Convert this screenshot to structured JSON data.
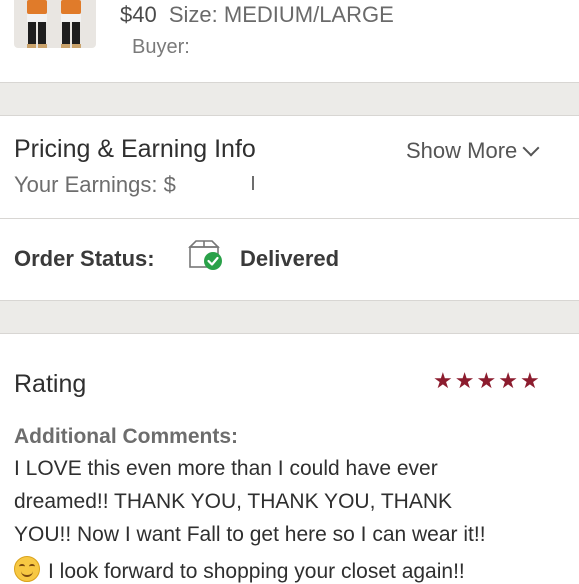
{
  "order": {
    "price": "$40",
    "size_label": "Size: MEDIUM/LARGE",
    "buyer_label": "Buyer:"
  },
  "pricing": {
    "title": "Pricing & Earning Info",
    "show_more": "Show More",
    "earnings_label": "Your Earnings: $"
  },
  "status": {
    "label": "Order Status:",
    "value": "Delivered",
    "icon": "package-delivered-icon"
  },
  "rating": {
    "title": "Rating",
    "stars": 5,
    "star_color": "#8c1c2e",
    "comments_label": "Additional Comments:",
    "comment_lines": [
      "I LOVE this even more than I could have ever",
      "dreamed!! THANK YOU, THANK YOU, THANK",
      "YOU!! Now I want Fall to get here so I can wear it!!",
      "I look forward to shopping your closet again!!"
    ]
  }
}
